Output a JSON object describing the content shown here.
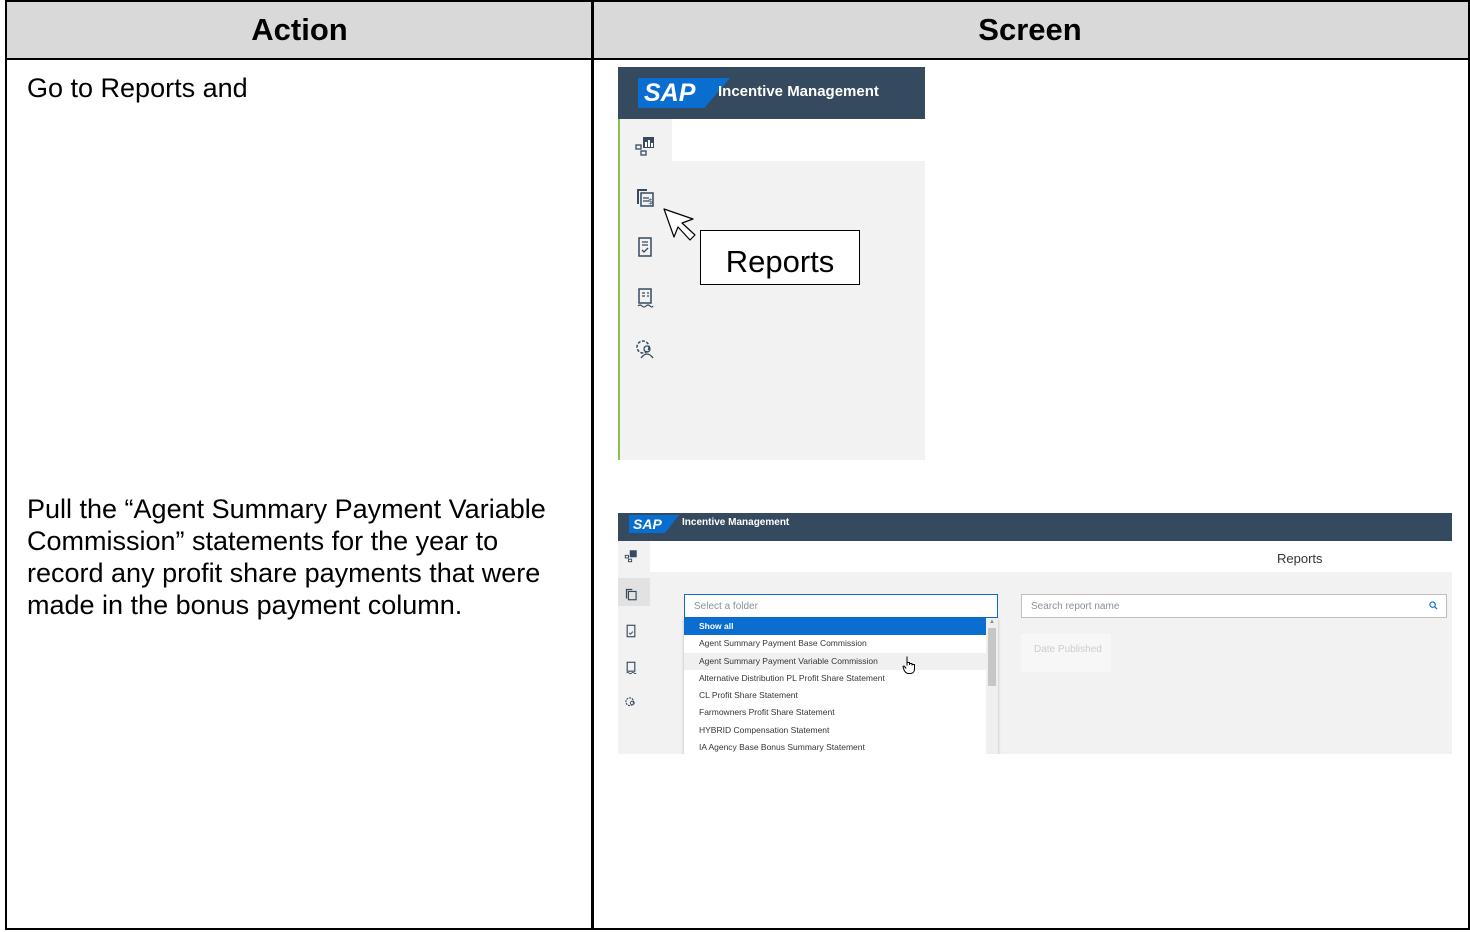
{
  "table": {
    "header_action": "Action",
    "header_screen": "Screen"
  },
  "steps": [
    {
      "text": "Go to Reports and"
    },
    {
      "text": "Pull the “Agent Summary Payment Variable Commission” statements for the year to record any profit share payments that were made in the bonus payment column."
    }
  ],
  "screenshot1": {
    "logo": "SAP",
    "app_title": "Incentive Management",
    "sidebar_icons": [
      "dashboard-icon",
      "reports-icon",
      "checklist-icon",
      "statement-icon",
      "admin-settings-icon"
    ],
    "callout": "Reports"
  },
  "screenshot2": {
    "logo": "SAP",
    "app_title": "Incentive Management",
    "page_title": "Reports",
    "folder_placeholder": "Select a folder",
    "search_placeholder": "Search report name",
    "column_header": "Date Published",
    "folder_options": [
      "Show all",
      "Agent Summary Payment Base Commission",
      "Agent Summary Payment Variable Commission",
      "Alternative Distribution PL Profit Share Statement",
      "CL Profit Share Statement",
      "Farmowners Profit Share Statement",
      "HYBRID Compensation Statement",
      "IA Agency Base Bonus Summary Statement"
    ],
    "selected_option": "Show all",
    "hovered_option": "Agent Summary Payment Variable Commission"
  },
  "colors": {
    "shell_header": "#354a5f",
    "sap_blue": "#0a6ed1",
    "sidebar_accent": "#8bc34a"
  }
}
